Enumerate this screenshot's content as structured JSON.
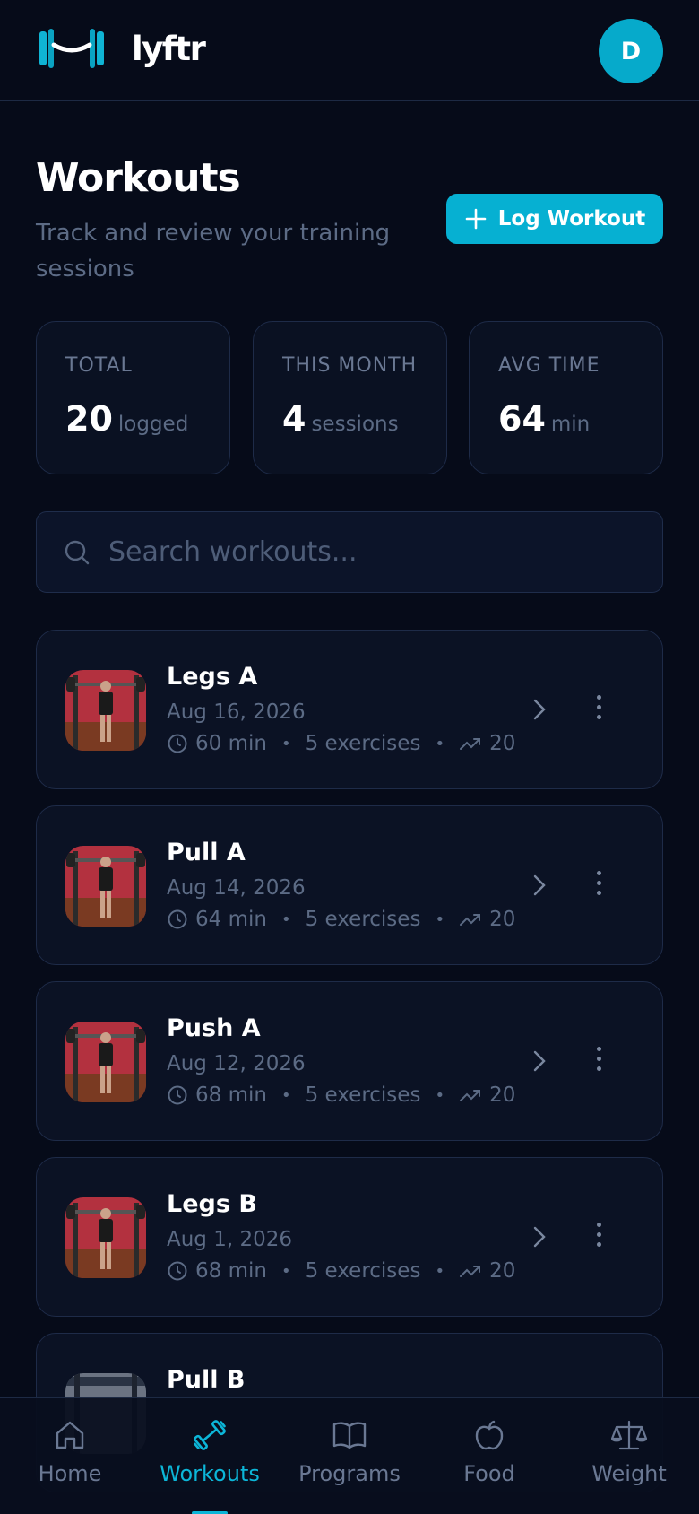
{
  "app": {
    "brand": "lyftr",
    "avatar_initial": "D",
    "accent": "#06b0d2"
  },
  "page": {
    "title": "Workouts",
    "subtitle": "Track and review your training sessions",
    "log_button": "Log Workout"
  },
  "stats": [
    {
      "label": "TOTAL",
      "value": "20",
      "unit": "logged"
    },
    {
      "label": "THIS MONTH",
      "value": "4",
      "unit": "sessions"
    },
    {
      "label": "AVG TIME",
      "value": "64",
      "unit": "min"
    }
  ],
  "search": {
    "placeholder": "Search workouts..."
  },
  "workouts": [
    {
      "name": "Legs A",
      "date": "Aug 16, 2026",
      "duration": "60 min",
      "exercises": "5 exercises",
      "trend": "20"
    },
    {
      "name": "Pull A",
      "date": "Aug 14, 2026",
      "duration": "64 min",
      "exercises": "5 exercises",
      "trend": "20"
    },
    {
      "name": "Push A",
      "date": "Aug 12, 2026",
      "duration": "68 min",
      "exercises": "5 exercises",
      "trend": "20"
    },
    {
      "name": "Legs B",
      "date": "Aug 1, 2026",
      "duration": "68 min",
      "exercises": "5 exercises",
      "trend": "20"
    },
    {
      "name": "Pull B"
    }
  ],
  "nav": [
    {
      "label": "Home",
      "icon": "home-icon"
    },
    {
      "label": "Workouts",
      "icon": "dumbbell-icon",
      "active": true
    },
    {
      "label": "Programs",
      "icon": "book-icon"
    },
    {
      "label": "Food",
      "icon": "apple-icon"
    },
    {
      "label": "Weight",
      "icon": "scale-icon"
    }
  ]
}
